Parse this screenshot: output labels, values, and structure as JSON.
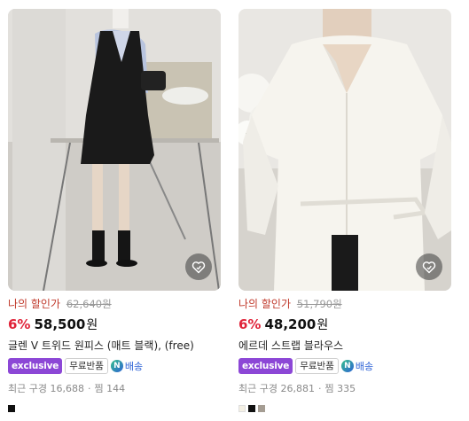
{
  "products": [
    {
      "member_label": "나의 할인가",
      "original_price": "62,640원",
      "discount": "6%",
      "price": "58,500",
      "currency": "원",
      "name": "글렌 V 트위드 원피스 (매트 블랙), (free)",
      "badges": {
        "exclusive": "exclusive",
        "free_return": "무료반품",
        "shipping": "배송",
        "shipping_icon": "N"
      },
      "stats": {
        "recent_label": "최근 구경",
        "recent_count": "16,688",
        "wish_label": "찜",
        "wish_count": "144"
      },
      "swatches": [
        "#111111"
      ],
      "icons": {
        "wishlist": "heart-icon"
      }
    },
    {
      "member_label": "나의 할인가",
      "original_price": "51,790원",
      "discount": "6%",
      "price": "48,200",
      "currency": "원",
      "name": "에르데 스트랩 블라우스",
      "badges": {
        "exclusive": "exclusive",
        "free_return": "무료반품",
        "shipping": "배송",
        "shipping_icon": "N"
      },
      "stats": {
        "recent_label": "최근 구경",
        "recent_count": "26,881",
        "wish_label": "찜",
        "wish_count": "335"
      },
      "swatches": [
        "#f4f0e4",
        "#111111",
        "#a59d93"
      ],
      "icons": {
        "wishlist": "heart-icon"
      }
    }
  ]
}
